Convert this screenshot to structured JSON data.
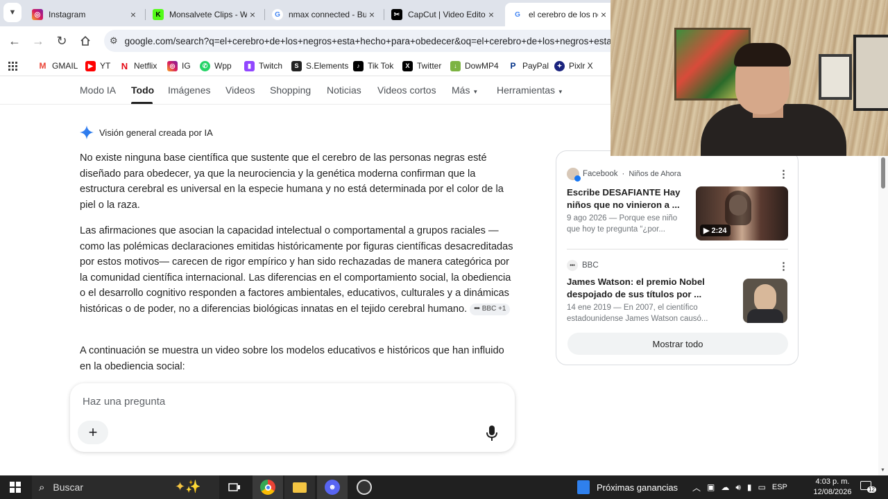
{
  "browser": {
    "tabs": [
      {
        "title": "Instagram",
        "icon": "instagram-icon"
      },
      {
        "title": "Monsalvete Clips - W",
        "icon": "kick-icon"
      },
      {
        "title": "nmax connected - Bu",
        "icon": "google-icon"
      },
      {
        "title": "CapCut | Video Edito",
        "icon": "capcut-icon"
      },
      {
        "title": "el cerebro de los neg",
        "icon": "google-icon"
      }
    ],
    "url": "google.com/search?q=el+cerebro+de+los+negros+esta+hecho+para+obedecer&oq=el+cerebro+de+los+negros+esta",
    "bookmarks": [
      {
        "label": "GMAIL",
        "icon": "gmail-icon"
      },
      {
        "label": "YT",
        "icon": "youtube-icon"
      },
      {
        "label": "Netflix",
        "icon": "netflix-icon"
      },
      {
        "label": "IG",
        "icon": "instagram-icon"
      },
      {
        "label": "Wpp",
        "icon": "whatsapp-icon"
      },
      {
        "label": "Twitch",
        "icon": "twitch-icon"
      },
      {
        "label": "S.Elements",
        "icon": "selements-icon"
      },
      {
        "label": "Tik Tok",
        "icon": "tiktok-icon"
      },
      {
        "label": "Twitter",
        "icon": "x-icon"
      },
      {
        "label": "DowMP4",
        "icon": "download-icon"
      },
      {
        "label": "PayPal",
        "icon": "paypal-icon"
      },
      {
        "label": "Pixlr X",
        "icon": "pixlr-icon"
      }
    ]
  },
  "search_tabs": [
    "Modo IA",
    "Todo",
    "Imágenes",
    "Videos",
    "Shopping",
    "Noticias",
    "Videos cortos",
    "Más",
    "Herramientas"
  ],
  "active_search_tab": "Todo",
  "ai_overview": {
    "header": "Visión general creada por IA",
    "para1": "No existe ninguna base científica que sustente que el cerebro de las personas negras esté diseñado para obedecer, ya que la neurociencia y la genética moderna confirman que la estructura cerebral es universal en la especie humana y no está determinada por el color de la piel o la raza.",
    "para2": "Las afirmaciones que asocian la capacidad intelectual o comportamental a grupos raciales —como las polémicas declaraciones emitidas históricamente por figuras científicas desacreditadas por estos motivos— carecen de rigor empírico y han sido rechazadas de manera categórica por la comunidad científica internacional. Las diferencias en el comportamiento social, la obediencia o el desarrollo cognitivo responden a factores ambientales, educativos, culturales y a dinámicas históricas o de poder, no a diferencias biológicas innatas en el tejido cerebral humano.",
    "chip": "BBC +1",
    "para3": "A continuación se muestra un video sobre los modelos educativos e históricos que han influido en la obediencia social:"
  },
  "ask_box": {
    "placeholder": "Haz una pregunta"
  },
  "sources_card": {
    "items": [
      {
        "source": "Facebook",
        "channel": "Niños de Ahora",
        "title": "Escribe DESAFIANTE Hay niños que no vinieron a ...",
        "meta": "9 ago 2026 — Porque ese niño que hoy te pregunta “¿por...",
        "duration": "2:24"
      },
      {
        "source": "BBC",
        "title": "James Watson: el premio Nobel despojado de sus títulos por ...",
        "meta": "14 ene 2019 — En 2007, el científico estadounidense James Watson causó..."
      }
    ],
    "show_all": "Mostrar todo"
  },
  "taskbar": {
    "search": "Buscar",
    "widget": "Próximas ganancias",
    "lang": "ESP",
    "time": "4:03 p. m.",
    "date": "12/08/2026",
    "notifications": "12"
  },
  "colors": {
    "accent": "#1a73e8",
    "tabstrip": "#dfe3eb",
    "taskbar": "#202020"
  }
}
